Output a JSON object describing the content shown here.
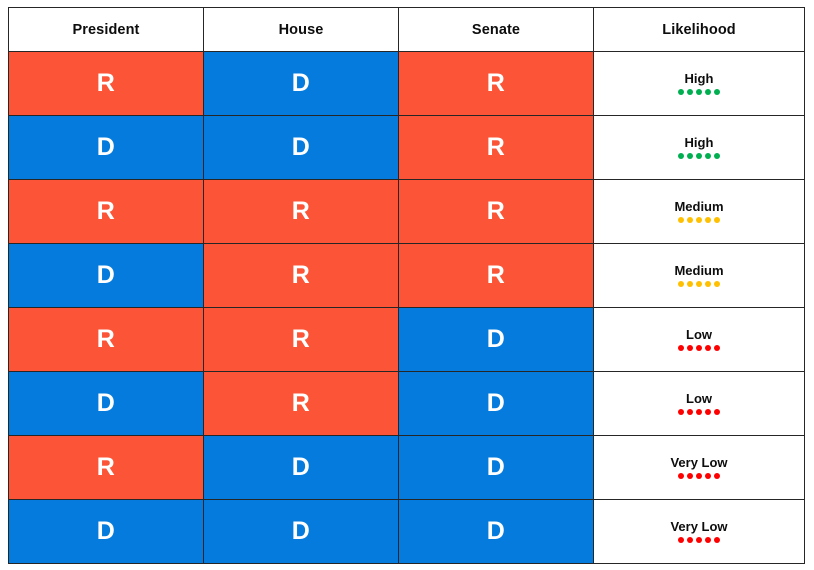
{
  "table": {
    "headers": [
      {
        "key": "president",
        "label": "President"
      },
      {
        "key": "house",
        "label": "House"
      },
      {
        "key": "senate",
        "label": "Senate"
      },
      {
        "key": "likelihood",
        "label": "Likelihood"
      }
    ],
    "party_labels": {
      "republican": "R",
      "democrat": "D"
    },
    "colors": {
      "republican": "#FB5436",
      "democrat": "#057CDD",
      "high": "#00B050",
      "medium": "#FFC000",
      "low": "#FF0000",
      "very_low": "#FF0000",
      "border": "#262626",
      "background": "#FFFFFF",
      "party_text": "#FFFFFF",
      "header_text": "#0D0D0D"
    },
    "dots_per_rating": 5,
    "rows": [
      {
        "president": "R",
        "house": "D",
        "senate": "R",
        "likelihood": "High",
        "rating": "high",
        "dot_color": "#00B050"
      },
      {
        "president": "D",
        "house": "D",
        "senate": "R",
        "likelihood": "High",
        "rating": "high",
        "dot_color": "#00B050"
      },
      {
        "president": "R",
        "house": "R",
        "senate": "R",
        "likelihood": "Medium",
        "rating": "medium",
        "dot_color": "#FFC000"
      },
      {
        "president": "D",
        "house": "R",
        "senate": "R",
        "likelihood": "Medium",
        "rating": "medium",
        "dot_color": "#FFC000"
      },
      {
        "president": "R",
        "house": "R",
        "senate": "D",
        "likelihood": "Low",
        "rating": "low",
        "dot_color": "#FF0000"
      },
      {
        "president": "D",
        "house": "R",
        "senate": "D",
        "likelihood": "Low",
        "rating": "low",
        "dot_color": "#FF0000"
      },
      {
        "president": "R",
        "house": "D",
        "senate": "D",
        "likelihood": "Very Low",
        "rating": "very-low",
        "dot_color": "#FF0000"
      },
      {
        "president": "D",
        "house": "D",
        "senate": "D",
        "likelihood": "Very Low",
        "rating": "very-low",
        "dot_color": "#FF0000"
      }
    ]
  }
}
